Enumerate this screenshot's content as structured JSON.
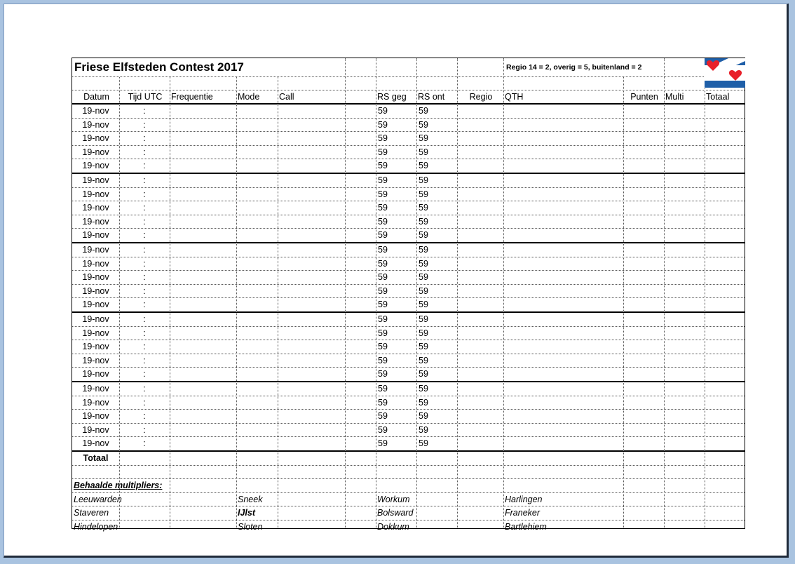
{
  "title": "Friese Elfsteden Contest 2017",
  "scoring_note": "Regio 14 = 2, overig = 5, buitenland = 2",
  "headers": [
    "Datum",
    "Tijd UTC",
    "Frequentie",
    "Mode",
    "Call",
    "RS geg",
    "RS ont",
    "Regio",
    "QTH",
    "Punten",
    "Multi",
    "Totaal"
  ],
  "log_rows": [
    {
      "datum": "19-nov",
      "tijd": ":",
      "rs_geg": "59",
      "rs_ont": "59"
    },
    {
      "datum": "19-nov",
      "tijd": ":",
      "rs_geg": "59",
      "rs_ont": "59"
    },
    {
      "datum": "19-nov",
      "tijd": ":",
      "rs_geg": "59",
      "rs_ont": "59"
    },
    {
      "datum": "19-nov",
      "tijd": ":",
      "rs_geg": "59",
      "rs_ont": "59"
    },
    {
      "datum": "19-nov",
      "tijd": ":",
      "rs_geg": "59",
      "rs_ont": "59"
    },
    {
      "datum": "19-nov",
      "tijd": ":",
      "rs_geg": "59",
      "rs_ont": "59"
    },
    {
      "datum": "19-nov",
      "tijd": ":",
      "rs_geg": "59",
      "rs_ont": "59"
    },
    {
      "datum": "19-nov",
      "tijd": ":",
      "rs_geg": "59",
      "rs_ont": "59"
    },
    {
      "datum": "19-nov",
      "tijd": ":",
      "rs_geg": "59",
      "rs_ont": "59"
    },
    {
      "datum": "19-nov",
      "tijd": ":",
      "rs_geg": "59",
      "rs_ont": "59"
    },
    {
      "datum": "19-nov",
      "tijd": ":",
      "rs_geg": "59",
      "rs_ont": "59"
    },
    {
      "datum": "19-nov",
      "tijd": ":",
      "rs_geg": "59",
      "rs_ont": "59"
    },
    {
      "datum": "19-nov",
      "tijd": ":",
      "rs_geg": "59",
      "rs_ont": "59"
    },
    {
      "datum": "19-nov",
      "tijd": ":",
      "rs_geg": "59",
      "rs_ont": "59"
    },
    {
      "datum": "19-nov",
      "tijd": ":",
      "rs_geg": "59",
      "rs_ont": "59"
    },
    {
      "datum": "19-nov",
      "tijd": ":",
      "rs_geg": "59",
      "rs_ont": "59"
    },
    {
      "datum": "19-nov",
      "tijd": ":",
      "rs_geg": "59",
      "rs_ont": "59"
    },
    {
      "datum": "19-nov",
      "tijd": ":",
      "rs_geg": "59",
      "rs_ont": "59"
    },
    {
      "datum": "19-nov",
      "tijd": ":",
      "rs_geg": "59",
      "rs_ont": "59"
    },
    {
      "datum": "19-nov",
      "tijd": ":",
      "rs_geg": "59",
      "rs_ont": "59"
    },
    {
      "datum": "19-nov",
      "tijd": ":",
      "rs_geg": "59",
      "rs_ont": "59"
    },
    {
      "datum": "19-nov",
      "tijd": ":",
      "rs_geg": "59",
      "rs_ont": "59"
    },
    {
      "datum": "19-nov",
      "tijd": ":",
      "rs_geg": "59",
      "rs_ont": "59"
    },
    {
      "datum": "19-nov",
      "tijd": ":",
      "rs_geg": "59",
      "rs_ont": "59"
    },
    {
      "datum": "19-nov",
      "tijd": ":",
      "rs_geg": "59",
      "rs_ont": "59"
    }
  ],
  "total_label": "Totaal",
  "multipliers_label": "Behaalde multipliers:",
  "multiplier_rows": [
    [
      "Leeuwarden",
      "Sneek",
      "Workum",
      "Harlingen"
    ],
    [
      "Staveren",
      "IJlst",
      "Bolsward",
      "Franeker"
    ],
    [
      "Hindelopen",
      "Sloten",
      "Dokkum",
      "Bartlehiem"
    ]
  ],
  "flag": {
    "icon": "friesland-flag-icon",
    "blue": "#1f5fa8",
    "red": "#e8202a"
  }
}
